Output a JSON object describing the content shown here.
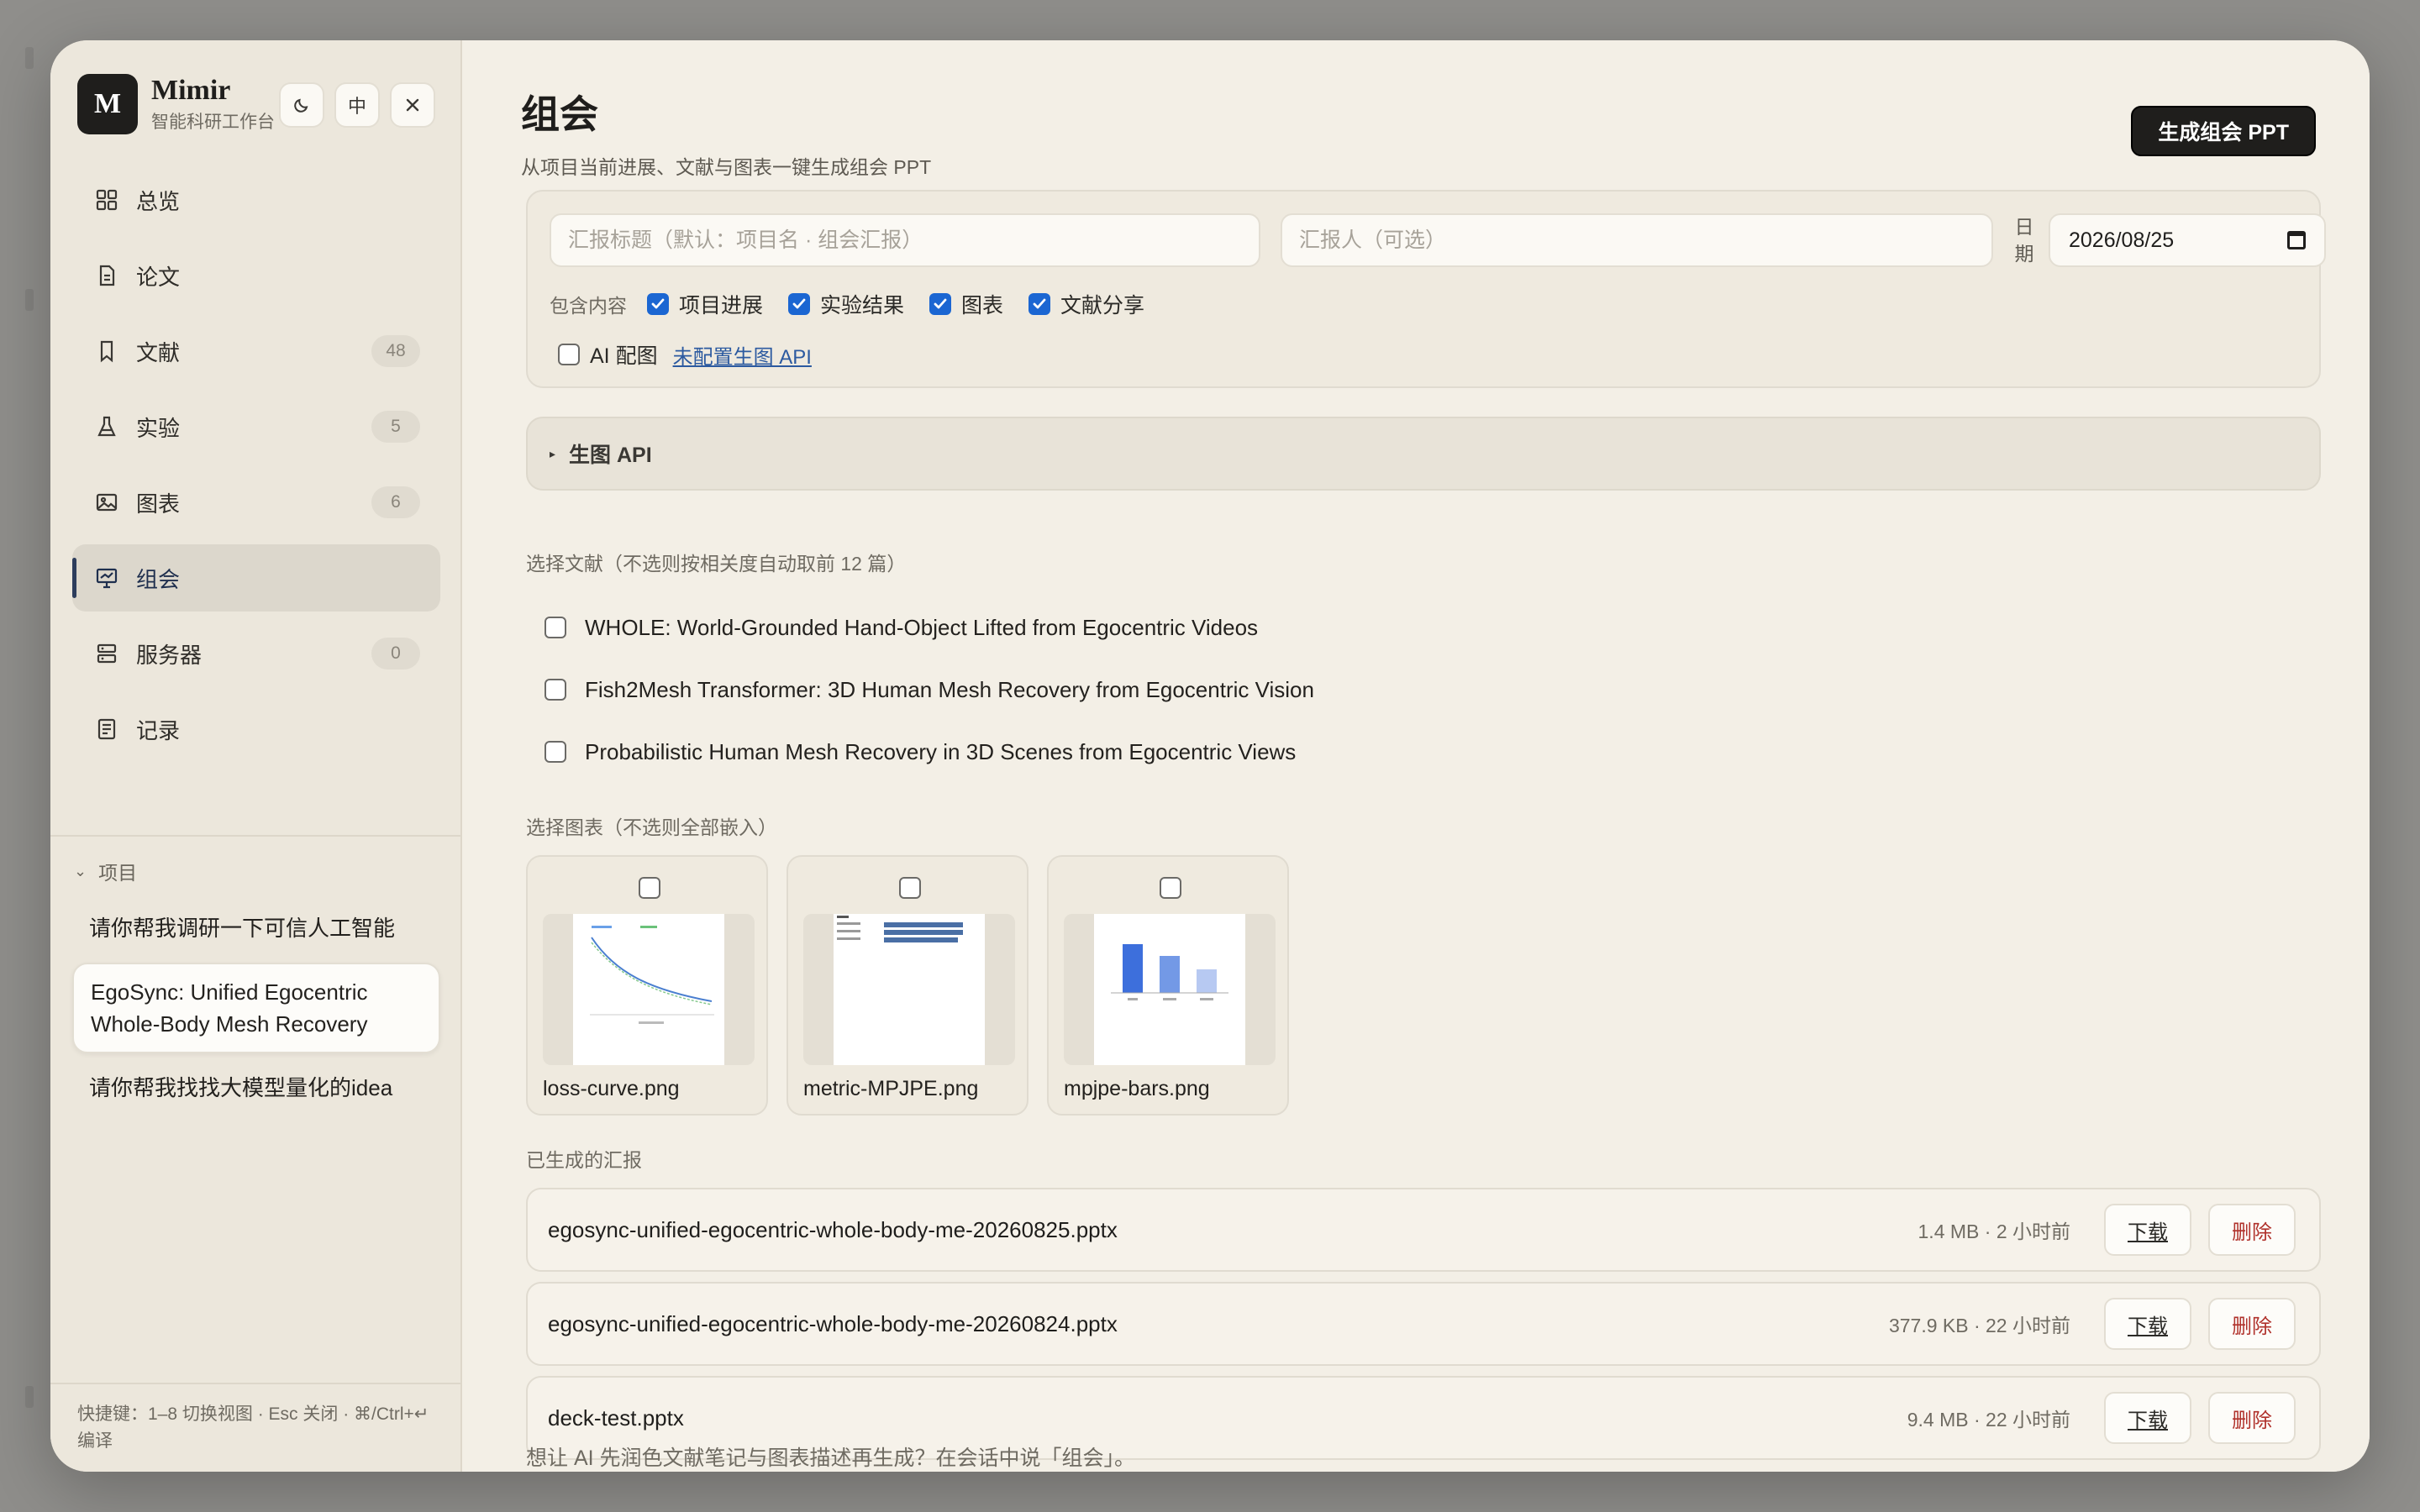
{
  "app": {
    "name": "Mimir",
    "subtitle": "智能科研工作台",
    "logo_letter": "M",
    "lang_toggle": "中"
  },
  "nav": [
    {
      "label": "总览",
      "icon": "grid-icon"
    },
    {
      "label": "论文",
      "icon": "document-icon"
    },
    {
      "label": "文献",
      "icon": "bookmark-icon",
      "count": "48"
    },
    {
      "label": "实验",
      "icon": "flask-icon",
      "count": "5"
    },
    {
      "label": "图表",
      "icon": "image-icon",
      "count": "6"
    },
    {
      "label": "组会",
      "icon": "presentation-icon",
      "active": true
    },
    {
      "label": "服务器",
      "icon": "server-icon",
      "count": "0"
    },
    {
      "label": "记录",
      "icon": "notes-icon"
    }
  ],
  "projects": {
    "header": "项目",
    "items": [
      "请你帮我调研一下可信人工智能",
      "EgoSync: Unified Egocentric Whole-Body Mesh Recovery",
      "请你帮我找找大模型量化的idea"
    ]
  },
  "shortcut_hint": "快捷键：1–8 切换视图 · Esc 关闭 · ⌘/Ctrl+↵ 编译",
  "page": {
    "title": "组会",
    "subtitle": "从项目当前进展、文献与图表一键生成组会 PPT",
    "generate_button": "生成组会 PPT"
  },
  "form": {
    "title_placeholder": "汇报标题（默认：项目名 · 组会汇报）",
    "presenter_placeholder": "汇报人（可选）",
    "date_label": "日期",
    "date_value": "2026/08/25",
    "include_label": "包含内容",
    "include_options": [
      {
        "label": "项目进展",
        "checked": true
      },
      {
        "label": "实验结果",
        "checked": true
      },
      {
        "label": "图表",
        "checked": true
      },
      {
        "label": "文献分享",
        "checked": true
      }
    ],
    "ai_figure_label": "AI 配图",
    "ai_figure_checked": false,
    "ai_api_link": "未配置生图 API"
  },
  "api_panel": {
    "label": "生图 API"
  },
  "literature": {
    "label": "选择文献（不选则按相关度自动取前 12 篇）",
    "items": [
      "WHOLE: World-Grounded Hand-Object Lifted from Egocentric Videos",
      "Fish2Mesh Transformer: 3D Human Mesh Recovery from Egocentric Vision",
      "Probabilistic Human Mesh Recovery in 3D Scenes from Egocentric Views"
    ]
  },
  "figures": {
    "label": "选择图表（不选则全部嵌入）",
    "items": [
      "loss-curve.png",
      "metric-MPJPE.png",
      "mpjpe-bars.png"
    ]
  },
  "reports": {
    "label": "已生成的汇报",
    "items": [
      {
        "name": "egosync-unified-egocentric-whole-body-me-20260825.pptx",
        "meta": "1.4 MB · 2 小时前"
      },
      {
        "name": "egosync-unified-egocentric-whole-body-me-20260824.pptx",
        "meta": "377.9 KB · 22 小时前"
      },
      {
        "name": "deck-test.pptx",
        "meta": "9.4 MB · 22 小时前"
      }
    ],
    "download_label": "下载",
    "delete_label": "删除"
  },
  "bottom_hint": "想让 AI 先润色文献笔记与图表描述再生成？在会话中说「组会」。",
  "colors": {
    "accent": "#1b66d2",
    "danger": "#b0312b",
    "primary_button": "#1f1e1c"
  }
}
